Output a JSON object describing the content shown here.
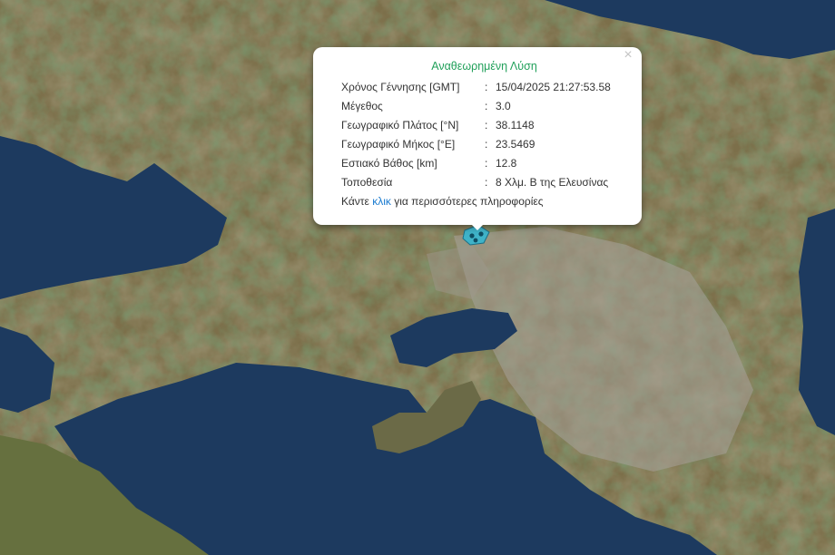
{
  "popup": {
    "title": "Αναθεωρημένη Λύση",
    "close": "×",
    "rows": [
      {
        "label": "Χρόνος Γέννησης [GMT]",
        "sep": ":",
        "value": "15/04/2025 21:27:53.58"
      },
      {
        "label": "Μέγεθος",
        "sep": ":",
        "value": "3.0"
      },
      {
        "label": "Γεωγραφικό Πλάτος [°N]",
        "sep": ":",
        "value": "38.1148"
      },
      {
        "label": "Γεωγραφικό Μήκος [°E]",
        "sep": ":",
        "value": "23.5469"
      },
      {
        "label": "Εστιακό Βάθος [km]",
        "sep": ":",
        "value": "12.8"
      },
      {
        "label": "Τοποθεσία",
        "sep": ":",
        "value": "8 Χλμ. Β της Ελευσίνας"
      }
    ],
    "more_before": "Κάντε ",
    "more_link": "κλικ",
    "more_after": " για περισσότερες πληροφορίες"
  },
  "marker": {
    "icon": "earthquake-marker-icon",
    "color": "#3fb3c8"
  },
  "colors": {
    "accent_title": "#21a05a",
    "link": "#1a7bd0",
    "sea": "#1d3a5f",
    "land": "#6f6f44"
  }
}
